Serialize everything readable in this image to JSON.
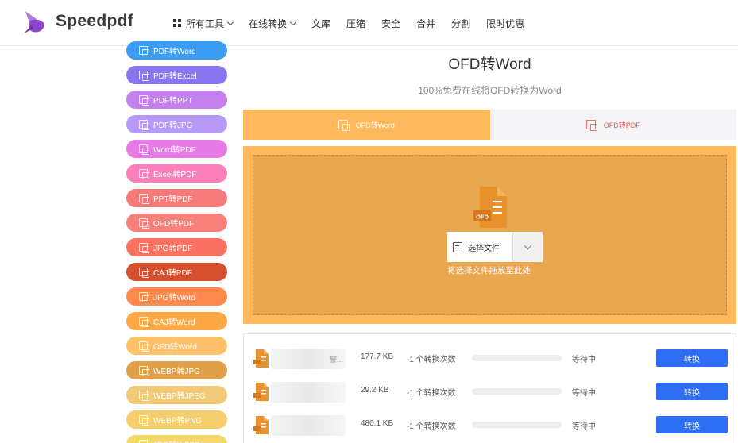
{
  "header": {
    "brand": "Speedpdf",
    "nav": [
      {
        "label": "所有工具",
        "dropdown": true,
        "grid": true
      },
      {
        "label": "在线转换",
        "dropdown": true,
        "grid": false
      },
      {
        "label": "文库",
        "dropdown": false,
        "grid": false
      },
      {
        "label": "压缩",
        "dropdown": false,
        "grid": false
      },
      {
        "label": "安全",
        "dropdown": false,
        "grid": false
      },
      {
        "label": "合并",
        "dropdown": false,
        "grid": false
      },
      {
        "label": "分割",
        "dropdown": false,
        "grid": false
      },
      {
        "label": "限时优惠",
        "dropdown": false,
        "grid": false
      }
    ]
  },
  "sidebar": {
    "items": [
      {
        "label": "PDF转Word",
        "color": "#3b9cf2"
      },
      {
        "label": "PDF转Excel",
        "color": "#8a76ee"
      },
      {
        "label": "PDF转PPT",
        "color": "#c580f0"
      },
      {
        "label": "PDF转JPG",
        "color": "#b79af5"
      },
      {
        "label": "Word转PDF",
        "color": "#e87ae8"
      },
      {
        "label": "Excel转PDF",
        "color": "#fb7fbb"
      },
      {
        "label": "PPT转PDF",
        "color": "#f57a7a"
      },
      {
        "label": "OFD转PDF",
        "color": "#f8807a"
      },
      {
        "label": "JPG转PDF",
        "color": "#fb7262"
      },
      {
        "label": "CAJ转PDF",
        "color": "#d6502f"
      },
      {
        "label": "JPG转Word",
        "color": "#ff8a4e"
      },
      {
        "label": "CAJ转Word",
        "color": "#ffa848"
      },
      {
        "label": "OFD转Word",
        "color": "#ffc26a"
      },
      {
        "label": "WEBP转JPG",
        "color": "#e0a04a"
      },
      {
        "label": "WEBP转JPEG",
        "color": "#f2c978"
      },
      {
        "label": "WEBP转PNG",
        "color": "#f5cf6e"
      },
      {
        "label": "JPG转WEBP",
        "color": "#f3d86a"
      }
    ]
  },
  "main": {
    "title": "OFD转Word",
    "subtitle": "100%免费在线将OFD转换为Word",
    "tabs": [
      {
        "label": "OFD转Word",
        "active": true
      },
      {
        "label": "OFD转PDF",
        "active": false
      }
    ],
    "file_icon_label": "OFD",
    "choose_label": "选择文件",
    "drop_hint": "将选择文件拖放至此处"
  },
  "files": [
    {
      "name_tail": "警...",
      "size": "177.7 KB",
      "count": "-1 个转换次数",
      "status": "等待中",
      "action": "转换"
    },
    {
      "name_tail": "",
      "size": "29.2 KB",
      "count": "-1 个转换次数",
      "status": "等待中",
      "action": "转换"
    },
    {
      "name_tail": "",
      "size": "480.1 KB",
      "count": "-1 个转换次数",
      "status": "等待中",
      "action": "转换"
    }
  ],
  "colors": {
    "accent": "#ffb95c",
    "button": "#2d6ef3",
    "file_icon": "#e8922e"
  }
}
